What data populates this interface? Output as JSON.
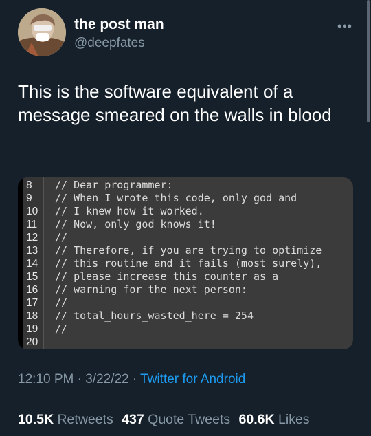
{
  "author": {
    "name": "the post man",
    "handle": "@deepfates"
  },
  "tweet": {
    "text": "This is the software equivalent of a message smeared on the walls in blood"
  },
  "code_image": {
    "lines": [
      {
        "num": "8",
        "text": "// Dear programmer:"
      },
      {
        "num": "9",
        "text": "// When I wrote this code, only god and"
      },
      {
        "num": "10",
        "text": "// I knew how it worked."
      },
      {
        "num": "11",
        "text": "// Now, only god knows it!"
      },
      {
        "num": "12",
        "text": "//"
      },
      {
        "num": "13",
        "text": "// Therefore, if you are trying to optimize"
      },
      {
        "num": "14",
        "text": "// this routine and it fails (most surely),"
      },
      {
        "num": "15",
        "text": "// please increase this counter as a"
      },
      {
        "num": "16",
        "text": "// warning for the next person:"
      },
      {
        "num": "17",
        "text": "//"
      },
      {
        "num": "18",
        "text": "// total_hours_wasted_here = 254"
      },
      {
        "num": "19",
        "text": "//"
      },
      {
        "num": "20",
        "text": ""
      }
    ]
  },
  "meta": {
    "time": "12:10 PM",
    "sep1": " · ",
    "date": "3/22/22",
    "sep2": " · ",
    "source": "Twitter for Android"
  },
  "stats": {
    "retweets_count": "10.5K",
    "retweets_label": "Retweets",
    "quotes_count": "437",
    "quotes_label": "Quote Tweets",
    "likes_count": "60.6K",
    "likes_label": "Likes"
  },
  "icons": {
    "more": "more-options-icon",
    "avatar": "user-avatar"
  },
  "colors": {
    "background": "#15202b",
    "secondary_text": "#8899a6",
    "link": "#1d9bf0"
  }
}
